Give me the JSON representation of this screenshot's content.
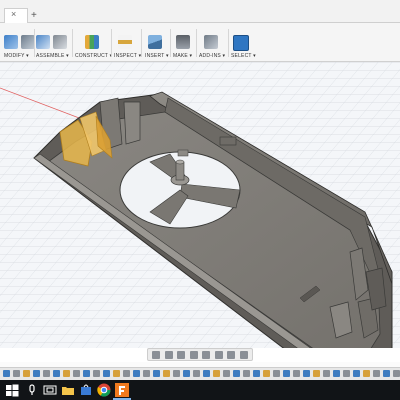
{
  "tabs": {
    "close_glyph": "×",
    "add_glyph": "+"
  },
  "toolbar": {
    "groups": [
      {
        "label": "MODIFY ▾",
        "icons": [
          "modify-push-icon",
          "modify-fillet-icon"
        ]
      },
      {
        "label": "ASSEMBLE ▾",
        "icons": [
          "new-component-icon",
          "joint-icon"
        ]
      },
      {
        "label": "CONSTRUCT ▾",
        "icons": [
          "offset-plane-icon"
        ]
      },
      {
        "label": "INSPECT ▾",
        "icons": [
          "measure-icon"
        ]
      },
      {
        "label": "INSERT ▾",
        "icons": [
          "insert-image-icon"
        ]
      },
      {
        "label": "MAKE ▾",
        "icons": [
          "3d-print-icon"
        ]
      },
      {
        "label": "ADD-INS ▾",
        "icons": [
          "scripts-icon"
        ]
      },
      {
        "label": "SELECT ▾",
        "icons": [
          "select-arrow-icon"
        ]
      }
    ]
  },
  "colors": {
    "accent": "#1f6fbf",
    "model_body": "#807d78",
    "model_edge": "#3a3a38",
    "highlight": "#e8b64a",
    "grid": "#c9ced6",
    "taskbar": "#111417"
  },
  "navbar": {
    "icons": [
      "orbit-icon",
      "pan-icon",
      "look-at-icon",
      "zoom-icon",
      "fit-icon",
      "display-settings-icon",
      "grid-settings-icon",
      "viewports-icon"
    ]
  },
  "taskbar": {
    "icons": [
      "windows-start-icon",
      "search-icon",
      "task-view-icon",
      "file-explorer-icon",
      "store-icon",
      "chrome-icon",
      "fusion360-icon"
    ]
  }
}
